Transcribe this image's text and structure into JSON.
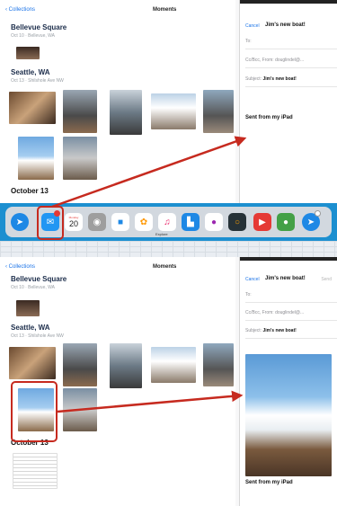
{
  "photos": {
    "back_label": "Collections",
    "title": "Moments",
    "groups": [
      {
        "place": "Bellevue Square",
        "subtitle": "Oct 10 · Bellevue, WA"
      },
      {
        "place": "Seattle, WA",
        "subtitle": "Oct 13 · Shilshole Ave NW"
      }
    ],
    "next_section": "October 13"
  },
  "mail": {
    "cancel": "Cancel",
    "title": "Jim's new boat!",
    "send": "Send",
    "to_label": "To:",
    "ccbcc_label": "Cc/Bcc, From:",
    "ccbcc_value": "douglindel@...",
    "subject_label": "Subject:",
    "subject_value": "Jim's new boat!",
    "signature": "Sent from my iPad"
  },
  "dock": {
    "apps": [
      "safari",
      "mail",
      "calendar",
      "contacts",
      "files",
      "photos",
      "music",
      "explore",
      "game-center",
      "circle-app",
      "youtube",
      "messages",
      "safari-2"
    ],
    "calendar_day": "Monday",
    "calendar_date": "20",
    "explore_label": "Explore"
  },
  "colors": {
    "annotation": "#c62a1f",
    "link": "#1a73e8",
    "dock_blue": "#1c8fd0"
  }
}
